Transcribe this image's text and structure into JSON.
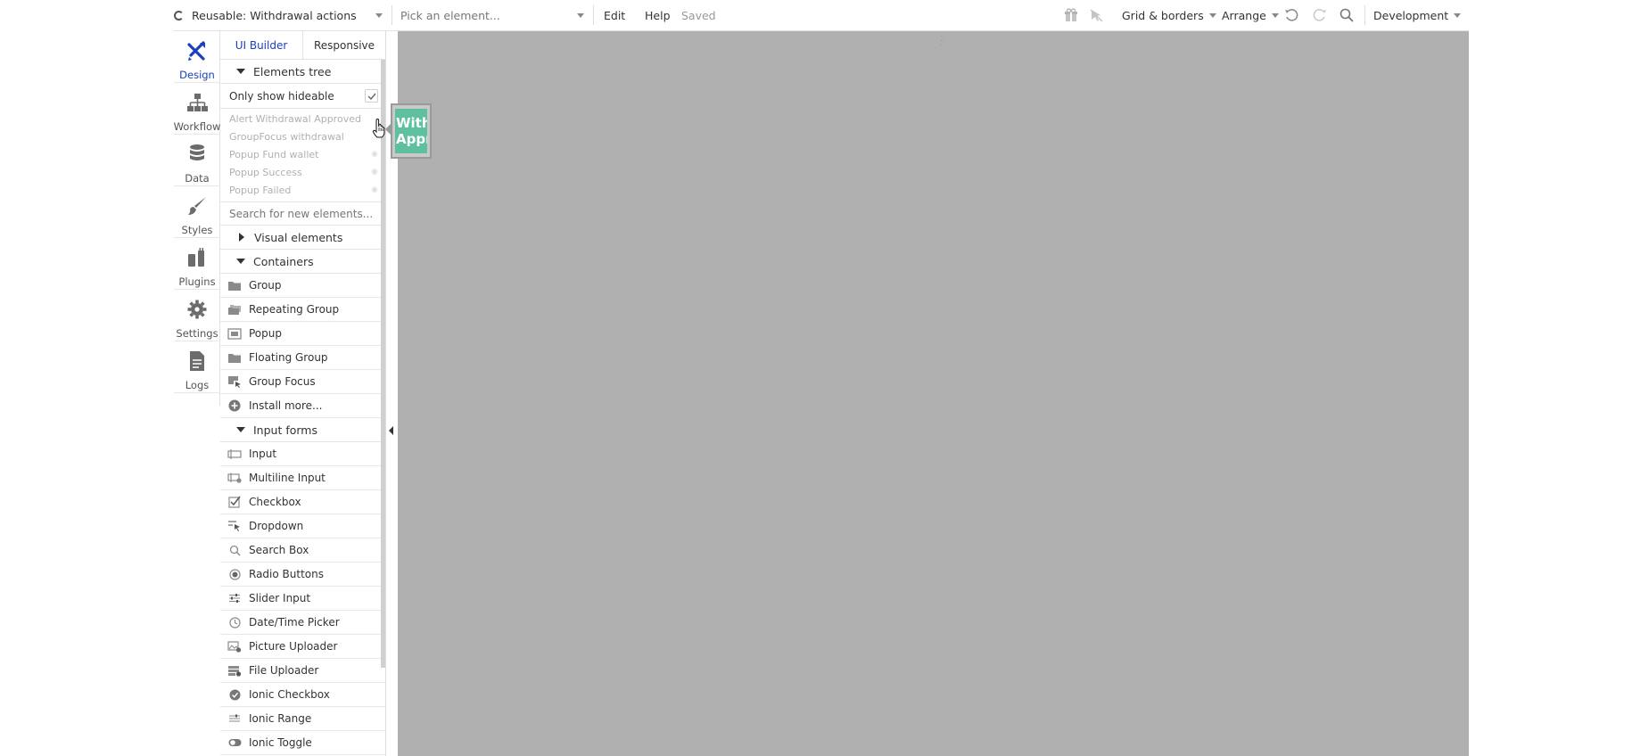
{
  "topbar": {
    "page_name": "Reusable: Withdrawal actions",
    "element_picker_placeholder": "Pick an element...",
    "edit_label": "Edit",
    "help_label": "Help",
    "saved_status": "Saved",
    "grid_label": "Grid & borders",
    "arrange_label": "Arrange",
    "environment_label": "Development"
  },
  "rail": {
    "items": [
      {
        "label": "Design",
        "icon": "design-icon"
      },
      {
        "label": "Workflow",
        "icon": "workflow-icon"
      },
      {
        "label": "Data",
        "icon": "database-icon"
      },
      {
        "label": "Styles",
        "icon": "brush-icon"
      },
      {
        "label": "Plugins",
        "icon": "plugin-icon"
      },
      {
        "label": "Settings",
        "icon": "gear-icon"
      },
      {
        "label": "Logs",
        "icon": "logs-icon"
      }
    ],
    "active_color": "#1a3fbf"
  },
  "panel": {
    "tabs": [
      "UI Builder",
      "Responsive"
    ],
    "elements_tree_label": "Elements tree",
    "only_hideable_label": "Only show hideable",
    "tree_items": [
      "Alert Withdrawal Approved",
      "GroupFocus withdrawal",
      "Popup Fund wallet",
      "Popup Success",
      "Popup Failed"
    ],
    "search_placeholder": "Search for new elements...",
    "visual_elements_label": "Visual elements",
    "containers_label": "Containers",
    "containers": [
      "Group",
      "Repeating Group",
      "Popup",
      "Floating Group",
      "Group Focus",
      "Install more..."
    ],
    "input_forms_label": "Input forms",
    "input_forms": [
      "Input",
      "Multiline Input",
      "Checkbox",
      "Dropdown",
      "Search Box",
      "Radio Buttons",
      "Slider Input",
      "Date/Time Picker",
      "Picture Uploader",
      "File Uploader",
      "Ionic Checkbox",
      "Ionic Range",
      "Ionic Toggle"
    ]
  },
  "canvas": {
    "background": "#b0b0b0",
    "reusable_element_text_line1": "With",
    "reusable_element_text_line2": "Appr",
    "reusable_color": "#5fc0a0"
  }
}
